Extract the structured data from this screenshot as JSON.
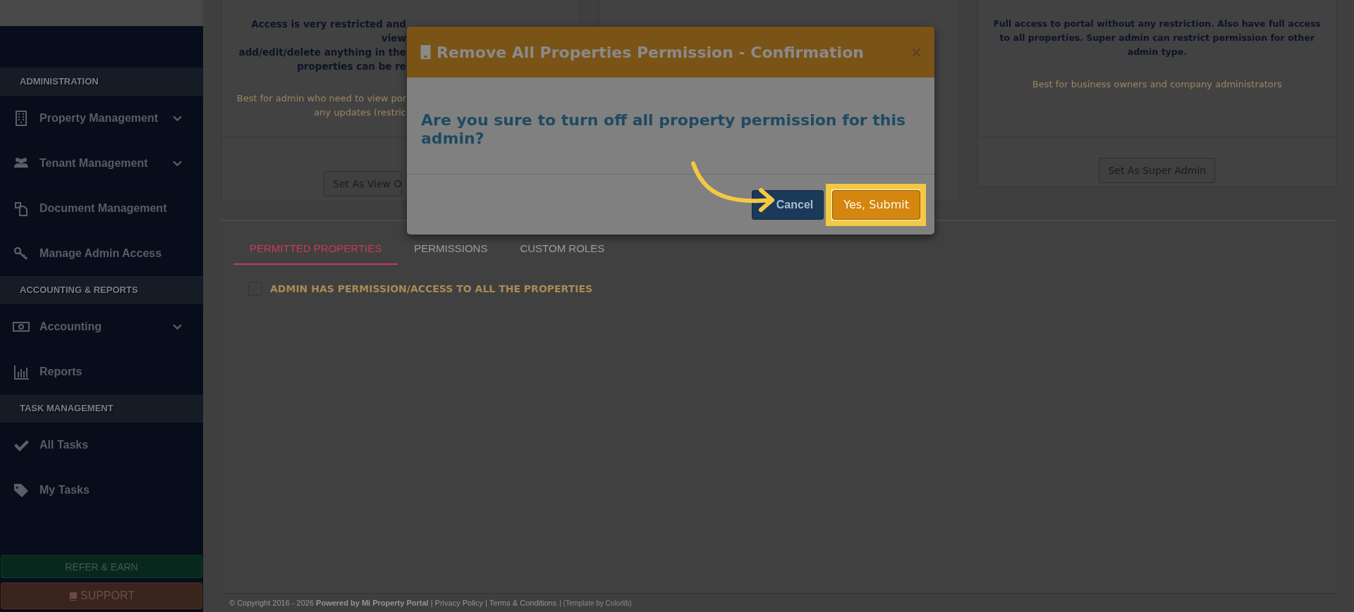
{
  "sidebar": {
    "sections": [
      {
        "title": "ADMINISTRATION",
        "items": [
          {
            "label": "Property Management",
            "expandable": true
          },
          {
            "label": "Tenant Management",
            "expandable": true
          },
          {
            "label": "Document Management",
            "expandable": false
          },
          {
            "label": "Manage Admin Access",
            "expandable": false
          }
        ]
      },
      {
        "title": "ACCOUNTING & REPORTS",
        "items": [
          {
            "label": "Accounting",
            "expandable": true
          },
          {
            "label": "Reports",
            "expandable": false
          }
        ]
      },
      {
        "title": "TASK MANAGEMENT",
        "items": [
          {
            "label": "All Tasks",
            "expandable": false
          },
          {
            "label": "My Tasks",
            "expandable": false
          }
        ]
      }
    ],
    "refer_button": "REFER & EARN",
    "support_button": "SUPPORT"
  },
  "admin_types": [
    {
      "description_lines": [
        "Access is very restricted and view",
        "add/edit/delete anything in the",
        "properties can be re"
      ],
      "hint_lines": [
        "Best for admin who need to view por",
        "any updates (restric"
      ],
      "button": "Set As View O"
    },
    {
      "description_lines": [
        "Full access to portal without any restriction. Also have full access",
        "to all properties. Super admin can restrict permission for other",
        "admin type."
      ],
      "hint_lines": [
        "Best for business owners and company administrators"
      ],
      "button": "Set As Super Admin"
    }
  ],
  "tabs": [
    {
      "label": "PERMITTED PROPERTIES",
      "selected": true
    },
    {
      "label": "PERMISSIONS",
      "selected": false
    },
    {
      "label": "CUSTOM ROLES",
      "selected": false
    }
  ],
  "all_properties_checkbox": {
    "label": "ADMIN HAS PERMISSION/ACCESS TO ALL THE PROPERTIES",
    "checked": false
  },
  "footer": {
    "text": "© Copyright 2016 - 2026 **Powered by Mi Property Portal** | Privacy Policy | Terms & Conditions",
    "template_note": "| (Template by Colorlib)"
  },
  "modal": {
    "title": "Remove All Properties Permission - Confirmation",
    "close": "×",
    "question": "Are you sure to turn off all property permission for this admin?",
    "buttons": [
      {
        "label": "Cancel",
        "kind": "secondary",
        "highlighted": false
      },
      {
        "label": "Yes, Submit",
        "kind": "primary",
        "highlighted": true
      }
    ]
  }
}
